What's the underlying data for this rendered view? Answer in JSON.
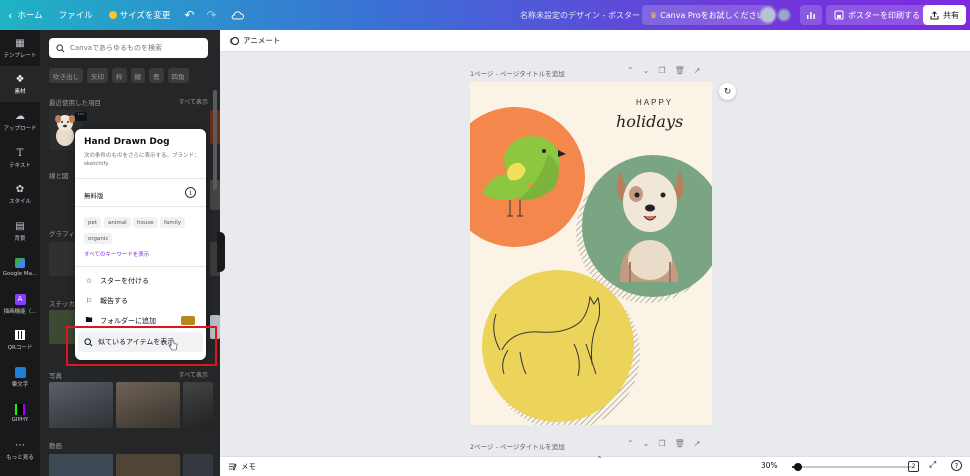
{
  "topbar": {
    "home": "ホーム",
    "file": "ファイル",
    "resize": "サイズを変更",
    "title": "名称未設定のデザイン - ポスター",
    "pro_cta": "Canva Proをお試しください",
    "print": "ポスターを印刷する",
    "share": "共有"
  },
  "rail": {
    "items": [
      {
        "label": "テンプレート",
        "icon": "template-icon"
      },
      {
        "label": "素材",
        "icon": "elements-icon"
      },
      {
        "label": "アップロード",
        "icon": "upload-icon"
      },
      {
        "label": "テキスト",
        "icon": "text-icon"
      },
      {
        "label": "スタイル",
        "icon": "palette-icon"
      },
      {
        "label": "背景",
        "icon": "background-icon"
      },
      {
        "label": "Google Ma...",
        "icon": "google-maps-icon"
      },
      {
        "label": "描画機能（...",
        "icon": "draw-icon"
      },
      {
        "label": "QRコード",
        "icon": "qr-code-icon"
      },
      {
        "label": "筆文字",
        "icon": "brush-text-icon"
      },
      {
        "label": "GIPHY",
        "icon": "giphy-icon"
      },
      {
        "label": "もっと見る",
        "icon": "more-icon"
      }
    ]
  },
  "panel": {
    "search_placeholder": "Canvaであらゆるものを検索",
    "chips": [
      "吹き出し",
      "矢印",
      "枠",
      "線",
      "丟",
      "四角"
    ],
    "sections": {
      "recent": "最近使用した項目",
      "shapes_partial": "線と図",
      "graphics_partial": "グラフィ",
      "stickers_partial": "ステッカ",
      "photos": "写真",
      "videos": "動画",
      "see_all": "すべて表示"
    }
  },
  "popup": {
    "title": "Hand Drawn Dog",
    "description": "次の条件のものをさらに表示する。ブランド：sketchify",
    "license": "無料版",
    "tags": [
      "pet",
      "animal",
      "house",
      "family",
      "organic"
    ],
    "keywords_link": "すべてのキーワードを表示",
    "menu": {
      "star": "スターを付ける",
      "report": "報告する",
      "add_folder": "フォルダーに追加",
      "similar": "似ているアイテムを表示"
    }
  },
  "subbar": {
    "animate": "アニメート"
  },
  "canvas": {
    "page1_label": "1ページ - ページタイトルを追加",
    "page2_label": "2ページ - ページタイトルを追加",
    "poster_text_top": "HAPPY",
    "poster_text_script": "holidays"
  },
  "bottombar": {
    "memo": "メモ",
    "zoom": "30%",
    "zoom_fraction": 0.3,
    "page_count": "2"
  },
  "colors": {
    "gradient_start": "#1fb3c4",
    "gradient_end": "#7c2ae0",
    "circle_orange": "#f4874b",
    "circle_green": "#7aa583",
    "circle_yellow": "#ecd45a",
    "poster_bg": "#fbf4e6",
    "highlight_red": "#e0141c"
  }
}
